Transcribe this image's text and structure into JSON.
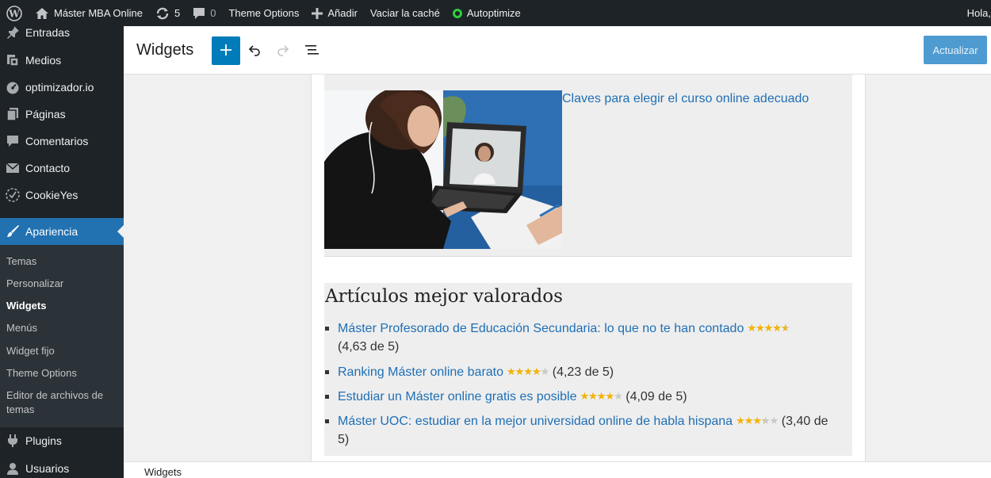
{
  "admin_bar": {
    "site_name": "Máster MBA Online",
    "updates_count": "5",
    "comments_count": "0",
    "theme_options": "Theme Options",
    "add_new": "Añadir",
    "clear_cache": "Vaciar la caché",
    "autoptimize": "Autoptimize",
    "greeting": "Hola, "
  },
  "sidebar": {
    "items": [
      {
        "label": "Entradas",
        "icon": "pin-icon"
      },
      {
        "label": "Medios",
        "icon": "media-icon"
      },
      {
        "label": "optimizador.io",
        "icon": "gauge-icon"
      },
      {
        "label": "Páginas",
        "icon": "pages-icon"
      },
      {
        "label": "Comentarios",
        "icon": "comment-icon"
      },
      {
        "label": "Contacto",
        "icon": "mail-icon"
      },
      {
        "label": "CookieYes",
        "icon": "cookie-check-icon"
      },
      {
        "label": "Apariencia",
        "icon": "brush-icon",
        "active": true
      },
      {
        "label": "Plugins",
        "icon": "plugin-icon"
      },
      {
        "label": "Usuarios",
        "icon": "user-icon"
      }
    ],
    "submenu": [
      {
        "label": "Temas"
      },
      {
        "label": "Personalizar"
      },
      {
        "label": "Widgets",
        "current": true
      },
      {
        "label": "Menús"
      },
      {
        "label": "Widget fijo"
      },
      {
        "label": "Theme Options"
      },
      {
        "label": "Editor de archivos de temas"
      }
    ]
  },
  "editor": {
    "title": "Widgets",
    "update_label": "Actualizar"
  },
  "content": {
    "post_link": "Claves para elegir el curso online adecuado",
    "rated_title": "Artículos mejor valorados",
    "rated_items": [
      {
        "title": "Máster Profesorado de Educación Secundaria: lo que no te han contado",
        "rating": 4.63,
        "score_text": "(4,63 de 5)"
      },
      {
        "title": "Ranking Máster online barato",
        "rating": 4.23,
        "score_text": "(4,23 de 5)"
      },
      {
        "title": "Estudiar un Máster online gratis es posible",
        "rating": 4.09,
        "score_text": "(4,09 de 5)"
      },
      {
        "title": "Máster UOC: estudiar en la mejor universidad online de habla hispana",
        "rating": 3.4,
        "score_text": "(3,40 de 5)"
      }
    ]
  },
  "footer": {
    "breadcrumb": "Widgets"
  },
  "colors": {
    "accent": "#2271b1",
    "admin_bar_bg": "#1d2327",
    "link": "#1f6fb5",
    "star": "#f5b301"
  }
}
